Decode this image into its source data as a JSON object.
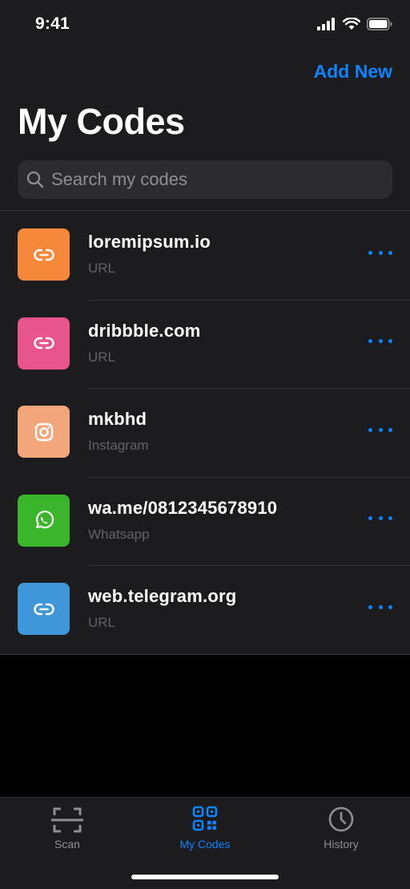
{
  "status": {
    "time": "9:41"
  },
  "header": {
    "add_new": "Add New",
    "title": "My Codes"
  },
  "search": {
    "placeholder": "Search my codes",
    "value": ""
  },
  "codes": [
    {
      "title": "loremipsum.io",
      "type": "URL",
      "color": "#f5883a",
      "icon": "link-icon"
    },
    {
      "title": "dribbble.com",
      "type": "URL",
      "color": "#e8548e",
      "icon": "link-icon"
    },
    {
      "title": "mkbhd",
      "type": "Instagram",
      "color": "#f3a57b",
      "icon": "instagram-icon"
    },
    {
      "title": "wa.me/0812345678910",
      "type": "Whatsapp",
      "color": "#3bb52c",
      "icon": "whatsapp-icon"
    },
    {
      "title": "web.telegram.org",
      "type": "URL",
      "color": "#3f96d8",
      "icon": "link-icon"
    }
  ],
  "tabs": [
    {
      "label": "Scan",
      "icon": "scan-icon",
      "active": false
    },
    {
      "label": "My Codes",
      "icon": "qr-code-icon",
      "active": true
    },
    {
      "label": "History",
      "icon": "clock-icon",
      "active": false
    }
  ],
  "colors": {
    "accent": "#0a84ff",
    "inactive": "#8e8e93"
  }
}
